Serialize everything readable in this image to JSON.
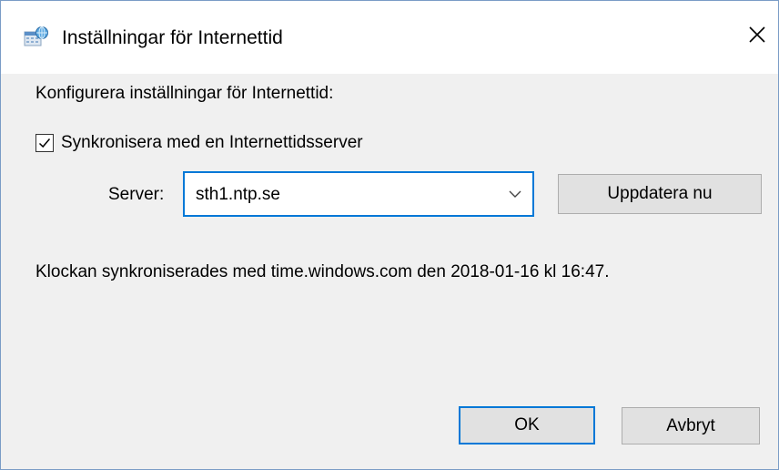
{
  "window": {
    "title": "Inställningar för Internettid",
    "icon": "internet-time-icon",
    "close_icon": "close-icon"
  },
  "content": {
    "instruction": "Konfigurera inställningar för Internettid:",
    "sync_checkbox": {
      "label": "Synkronisera med en Internettidsserver",
      "checked": true
    },
    "server": {
      "label": "Server:",
      "value": "sth1.ntp.se",
      "update_button": "Uppdatera nu"
    },
    "status": "Klockan synkroniserades med time.windows.com den 2018-01-16 kl 16:47."
  },
  "buttons": {
    "ok": "OK",
    "cancel": "Avbryt"
  },
  "colors": {
    "accent": "#0078d7",
    "button_face": "#e1e1e1",
    "dialog_background": "#f0f0f0"
  }
}
